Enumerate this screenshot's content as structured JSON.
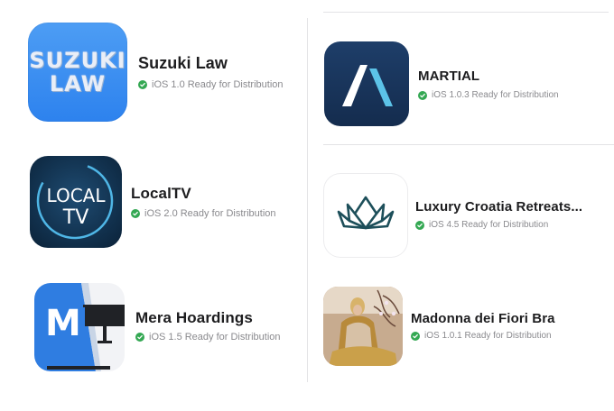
{
  "apps": [
    {
      "name": "Suzuki Law",
      "icon_text": [
        "SUZUKI",
        "LAW"
      ],
      "status": "iOS 1.0 Ready for Distribution"
    },
    {
      "name": "LocalTV",
      "icon_text": [
        "LOCAL",
        "TV"
      ],
      "status": "iOS 2.0 Ready for Distribution"
    },
    {
      "name": "Mera Hoardings",
      "icon_text": [
        "M"
      ],
      "status": "iOS 1.5 Ready for Distribution"
    },
    {
      "name": "MARTIAL",
      "status": "iOS 1.0.3 Ready for Distribution"
    },
    {
      "name": "Luxury Croatia Retreats...",
      "status": "iOS 4.5 Ready for Distribution"
    },
    {
      "name": "Madonna dei Fiori Bra",
      "status": "iOS 1.0.1 Ready for Distribution"
    }
  ],
  "colors": {
    "ready_check": "#34a853",
    "status_text": "#8a8a8e",
    "divider": "#e3e3e6"
  },
  "icons": {
    "status": "checkmark-circle-icon"
  }
}
